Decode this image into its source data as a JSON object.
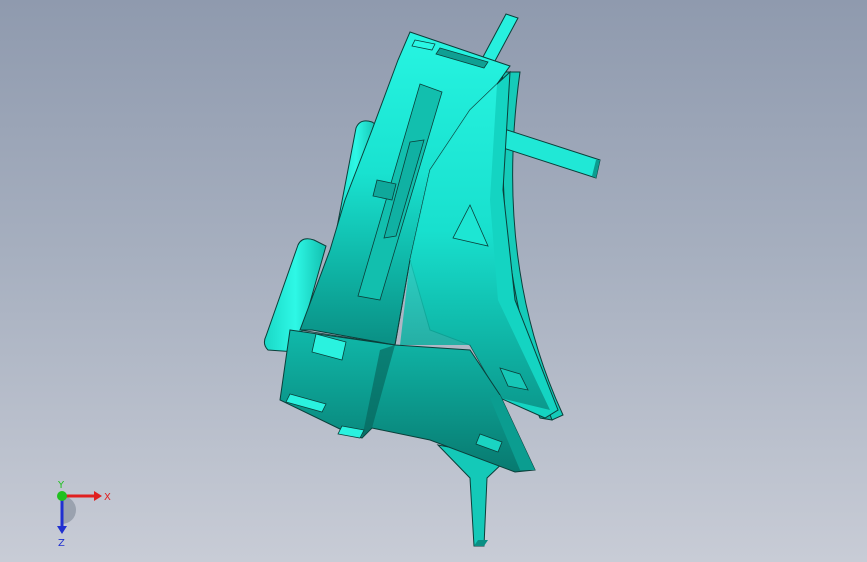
{
  "viewport": {
    "background_top": "#8f9aae",
    "background_bottom": "#c8ccd6"
  },
  "model": {
    "name": "cad-part",
    "colors": {
      "light": "#23f2e0",
      "mid": "#11cdbc",
      "dark": "#0a8f84",
      "shadow": "#066c63",
      "edge": "#0b3f3a"
    }
  },
  "triad": {
    "x_label": "X",
    "y_label": "Y",
    "z_label": "Z",
    "x_color": "#e02020",
    "y_color": "#20c020",
    "z_color": "#2030d0"
  }
}
